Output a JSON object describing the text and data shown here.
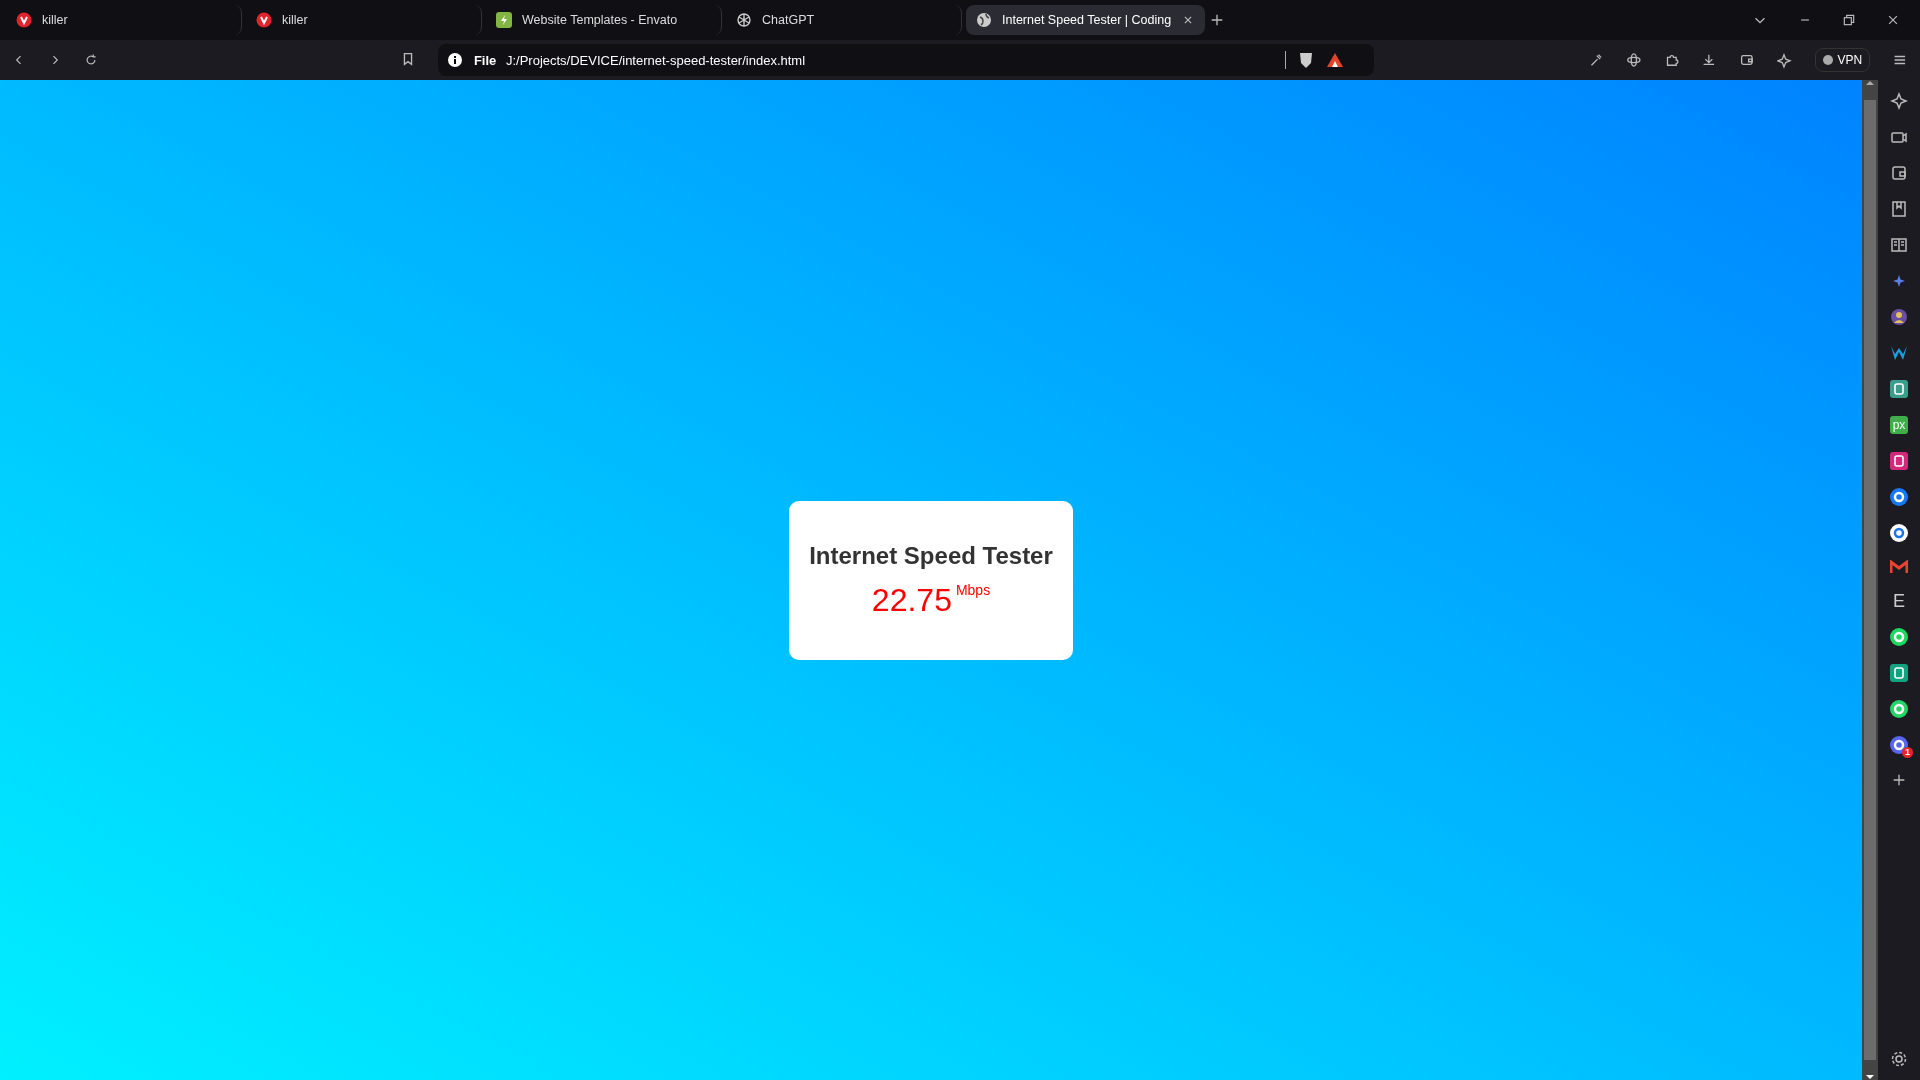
{
  "tabs": [
    {
      "title": "killer",
      "kind": "red-circle",
      "selected": false
    },
    {
      "title": "killer",
      "kind": "red-circle",
      "selected": false
    },
    {
      "title": "Website Templates - Envato",
      "kind": "leaf",
      "selected": false
    },
    {
      "title": "ChatGPT",
      "kind": "knot",
      "selected": false
    },
    {
      "title": "Internet Speed Tester | Coding",
      "kind": "globe",
      "selected": true
    }
  ],
  "address_bar": {
    "scheme": "File",
    "url": "J:/Projects/DEVICE/internet-speed-tester/index.html"
  },
  "toolbar": {
    "vpn": "VPN"
  },
  "sidebar": {
    "items": [
      {
        "kind": "star"
      },
      {
        "kind": "camera"
      },
      {
        "kind": "wallet"
      },
      {
        "kind": "bookmark"
      },
      {
        "kind": "reader"
      },
      {
        "kind": "sparkle"
      },
      {
        "kind": "avatar"
      },
      {
        "kind": "w-logo"
      },
      {
        "kind": "tile",
        "color": "#3a9e8c"
      },
      {
        "kind": "text-tile",
        "text": "px",
        "color": "#3fae49"
      },
      {
        "kind": "tile",
        "color": "#d6287a"
      },
      {
        "kind": "round",
        "color": "#1877f2"
      },
      {
        "kind": "round",
        "color": "#ffffff"
      },
      {
        "kind": "mail"
      },
      {
        "kind": "letter",
        "text": "E"
      },
      {
        "kind": "round",
        "color": "#1ed760"
      },
      {
        "kind": "tile",
        "color": "#10a37f"
      },
      {
        "kind": "round",
        "color": "#25d366"
      },
      {
        "kind": "round",
        "color": "#5865f2",
        "badge": "1"
      },
      {
        "kind": "plus"
      }
    ]
  },
  "card": {
    "title": "Internet Speed Tester",
    "speed": "22.75",
    "unit": "Mbps"
  }
}
